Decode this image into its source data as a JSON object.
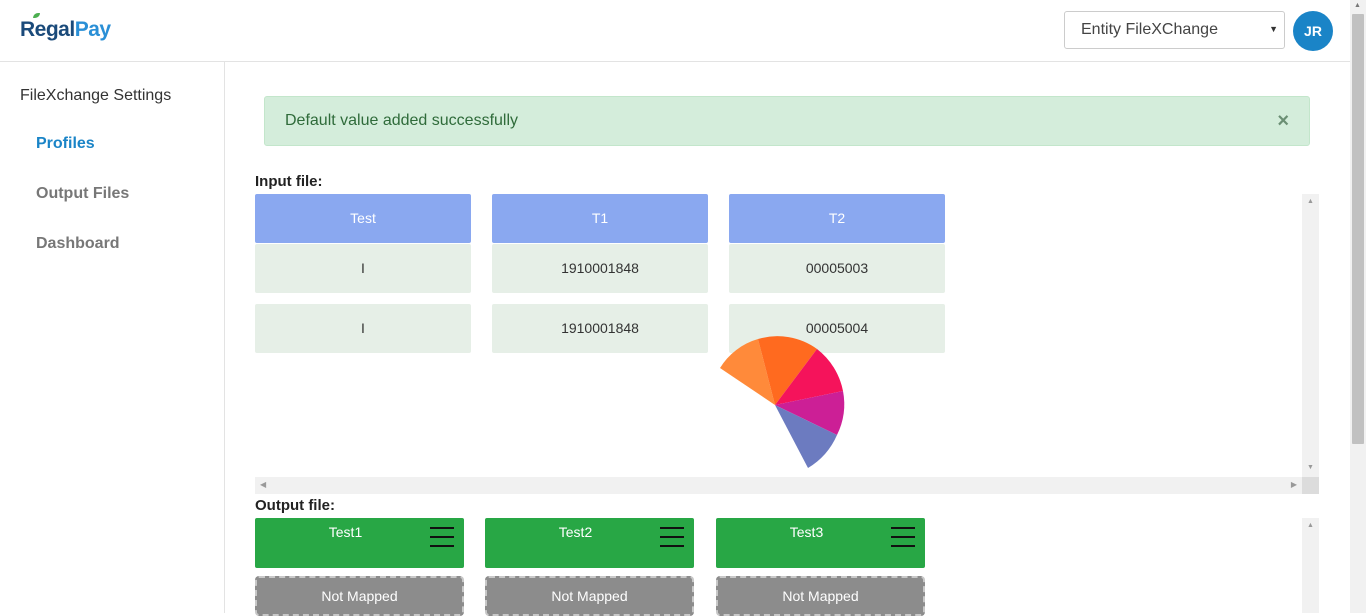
{
  "header": {
    "logo_part1": "Regal",
    "logo_part2": "Pay",
    "entity_select_value": "Entity FileXChange",
    "avatar_initials": "JR"
  },
  "sidebar": {
    "title": "FileXchange Settings",
    "items": [
      {
        "label": "Profiles",
        "active": true
      },
      {
        "label": "Output Files",
        "active": false
      },
      {
        "label": "Dashboard",
        "active": false
      }
    ]
  },
  "alert": {
    "message": "Default value added successfully",
    "close_symbol": "×"
  },
  "input_file": {
    "label": "Input file:",
    "columns": [
      "Test",
      "T1",
      "T2"
    ],
    "rows": [
      [
        "I",
        "1910001848",
        "00005003"
      ],
      [
        "I",
        "1910001848",
        "00005004"
      ]
    ]
  },
  "output_file": {
    "label": "Output file:",
    "columns": [
      {
        "name": "Test1",
        "status": "Not Mapped"
      },
      {
        "name": "Test2",
        "status": "Not Mapped"
      },
      {
        "name": "Test3",
        "status": "Not Mapped"
      }
    ]
  },
  "colors": {
    "accent": "#1a84c7",
    "input_header": "#8aa8f0",
    "input_cell": "#e6efe7",
    "output_header": "#28a745",
    "output_unmapped": "#8c8c8c",
    "alert_bg": "#d4eddb"
  },
  "icons": {
    "column_menu": "hamburger-menu-icon",
    "select_caret": "caret-down-icon",
    "loading_spinner": "pie-spinner-icon"
  }
}
